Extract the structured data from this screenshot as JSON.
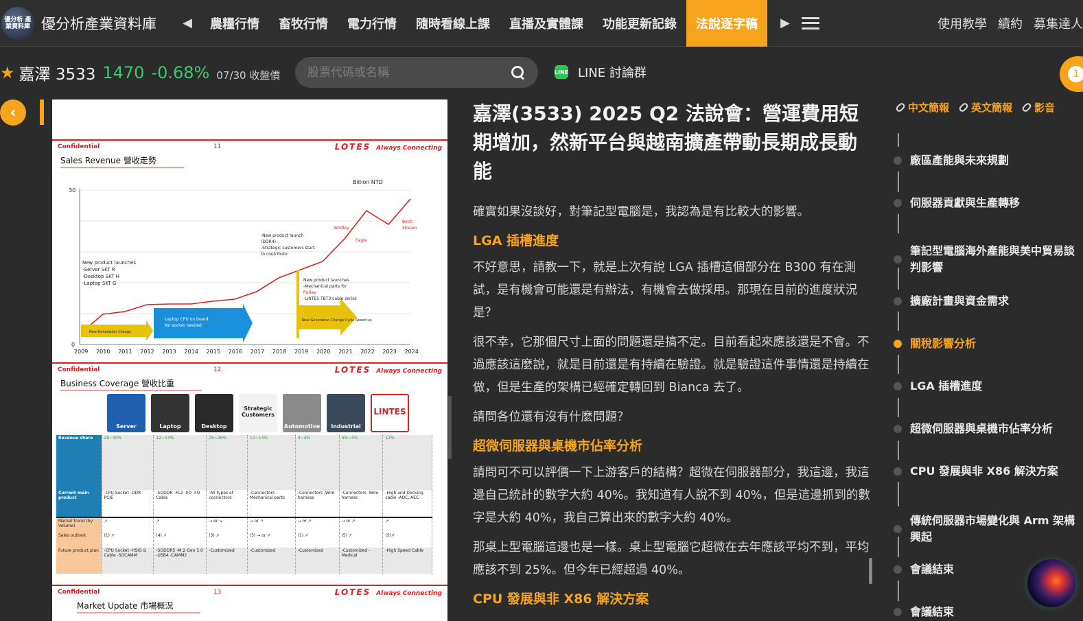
{
  "header": {
    "logo_text": "優分析\n產業資料庫",
    "site_title": "優分析產業資料庫",
    "nav_items": [
      {
        "label": "農糧行情"
      },
      {
        "label": "畜牧行情"
      },
      {
        "label": "電力行情"
      },
      {
        "label": "隨時看線上課"
      },
      {
        "label": "直播及實體課"
      },
      {
        "label": "功能更新記錄"
      },
      {
        "label": "法說逐字稿",
        "active": true
      }
    ],
    "right_links": [
      "使用教學",
      "續約",
      "募集達人"
    ]
  },
  "stock": {
    "name": "嘉澤 3533",
    "price": "1470",
    "change": "-0.68%",
    "date": "07/30 收盤價"
  },
  "search": {
    "placeholder": "股票代碼或名稱"
  },
  "line_group": {
    "label": "LINE 討論群"
  },
  "notification": {
    "count": "1"
  },
  "slides": [
    {
      "confidential": "Confidential",
      "page": "11",
      "brand": "LOTES",
      "tagline": "Always Connecting",
      "title": "Sales Revenue 營收走勢",
      "unit": "Billion NTD",
      "years": [
        "2009",
        "2010",
        "2011",
        "2012",
        "2013",
        "2014",
        "2015",
        "2016",
        "2017",
        "2018",
        "2019",
        "2020",
        "2021",
        "2022",
        "2023",
        "2024"
      ],
      "notes": [
        "New product launches",
        "-Server SKT R",
        "-Desktop SKT H",
        "-Laptop SKT G",
        "Laptop CPU on board",
        "No socket needed",
        "-New product launch",
        "(DDR4)",
        "-Strategic customers start",
        "to contribute",
        "New product launches",
        "-Mechanical parts for",
        "Purley",
        "-LINTES TBT3 cable series",
        "Whitley",
        "Eagle",
        "Birch",
        "Stream",
        "New Generation Change",
        "New Generation Change Cycle Speed up"
      ]
    },
    {
      "confidential": "Confidential",
      "page": "12",
      "brand": "LOTES",
      "tagline": "Always Connecting",
      "title": "Business Coverage 營收比重",
      "categories": [
        "Server",
        "Laptop",
        "Desktop",
        "Strategic Customers",
        "Automotive",
        "Industrial",
        "LINTES"
      ],
      "rows": [
        {
          "label": "Revenue share",
          "cells": [
            "29~30%",
            "12~13%",
            "25~26%",
            "12~13%",
            "3~4%",
            "4%~5%",
            "12%"
          ]
        },
        {
          "label": "Current main product",
          "cells": [
            "-CPU Socket -DDR -PCIE",
            "-SODDR -M.2 -I/O -FO Cable",
            "-All types of connectors",
            "-Connectors -Mechanical parts",
            "-Connectors -Wire harness",
            "-Connectors -Wire harness",
            "-High and Docking cable -AOC, AEC"
          ]
        },
        {
          "label": "Market trend (by Volume)",
          "cells": [
            "↗",
            "↗",
            "→ or ↘",
            "→ or ↗",
            "→ or ↗",
            "→ or ↗",
            "↗"
          ]
        },
        {
          "label": "Sales outlook",
          "cells": [
            "(1) ↗",
            "(4) ↗",
            "(3) ↗",
            "(5) → or ↗",
            "(1) ↗",
            "(5) ↗",
            "(5)↗"
          ]
        },
        {
          "label": "Future product plan",
          "cells": [
            "-CPU Socket -HSIO & Cable -SOCAMM",
            "-SODDR5 -M.2 Gen 5.0 -USB4 -CAMM2",
            "-Customized",
            "-Customized",
            "-Customized",
            "-Customized -Medical",
            "-High Speed Cable"
          ]
        }
      ]
    },
    {
      "confidential": "Confidential",
      "page": "13",
      "brand": "LOTES",
      "tagline": "Always Connecting",
      "title": "Market Update 市場概況"
    }
  ],
  "article": {
    "title": "嘉澤(3533) 2025 Q2 法說會：營運費用短期增加，然新平台與越南擴產帶動長期成長動能",
    "blocks": [
      {
        "type": "p",
        "text": "確實如果沒談好，對筆記型電腦是，我認為是有比較大的影響。"
      },
      {
        "type": "h",
        "text": "LGA 插槽進度"
      },
      {
        "type": "p",
        "text": "不好意思，請教一下，就是上次有說 LGA 插槽這個部分在 B300 有在測試，是有機會可能還是有辦法，有機會去做採用。那現在目前的進度狀況是？"
      },
      {
        "type": "p",
        "text": "很不幸，它那個尺寸上面的問題還是搞不定。目前看起來應該還是不會。不過應該這麼說，就是目前還是有持續在驗證。就是驗證這件事情還是持續在做，但是生產的架構已經確定轉回到 Bianca 去了。"
      },
      {
        "type": "p",
        "text": "請問各位還有沒有什麼問題？"
      },
      {
        "type": "h",
        "text": "超微伺服器與桌機市佔率分析"
      },
      {
        "type": "p",
        "text": "請問可不可以評價一下上游客戶的結構？超微在伺服器部分，我這邊，我這邊自己統計的數字大約 40%。我知道有人說不到 40%，但是這邊抓到的數字是大約 40%，我自己算出來的數字大約 40%。"
      },
      {
        "type": "p",
        "text": "那桌上型電腦這邊也是一樣。桌上型電腦它超微在去年應該平均不到，平均應該不到 25%。但今年已經超過 40%。"
      },
      {
        "type": "h",
        "text": "CPU 發展與非 X86 解決方案"
      }
    ]
  },
  "toc": {
    "tabs": [
      "中文簡報",
      "英文簡報",
      "影音"
    ],
    "items": [
      {
        "label": "廠區產能與未來規劃"
      },
      {
        "label": "伺服器貢獻與生產轉移"
      },
      {
        "label": "筆記型電腦海外產能與美中貿易談判影響"
      },
      {
        "label": "擴廠計畫與資金需求"
      },
      {
        "label": "關稅影響分析",
        "active": true
      },
      {
        "label": "LGA 插槽進度"
      },
      {
        "label": "超微伺服器與桌機市佔率分析"
      },
      {
        "label": "CPU 發展與非 X86 解決方案"
      },
      {
        "label": "傳統伺服器市場變化與 Arm 架構興起"
      },
      {
        "label": "會議結束"
      },
      {
        "label": "會議結束"
      }
    ]
  },
  "colors": {
    "accent": "#f7a31c",
    "up_green": "#3cc96a",
    "background": "#2b2b2b"
  }
}
